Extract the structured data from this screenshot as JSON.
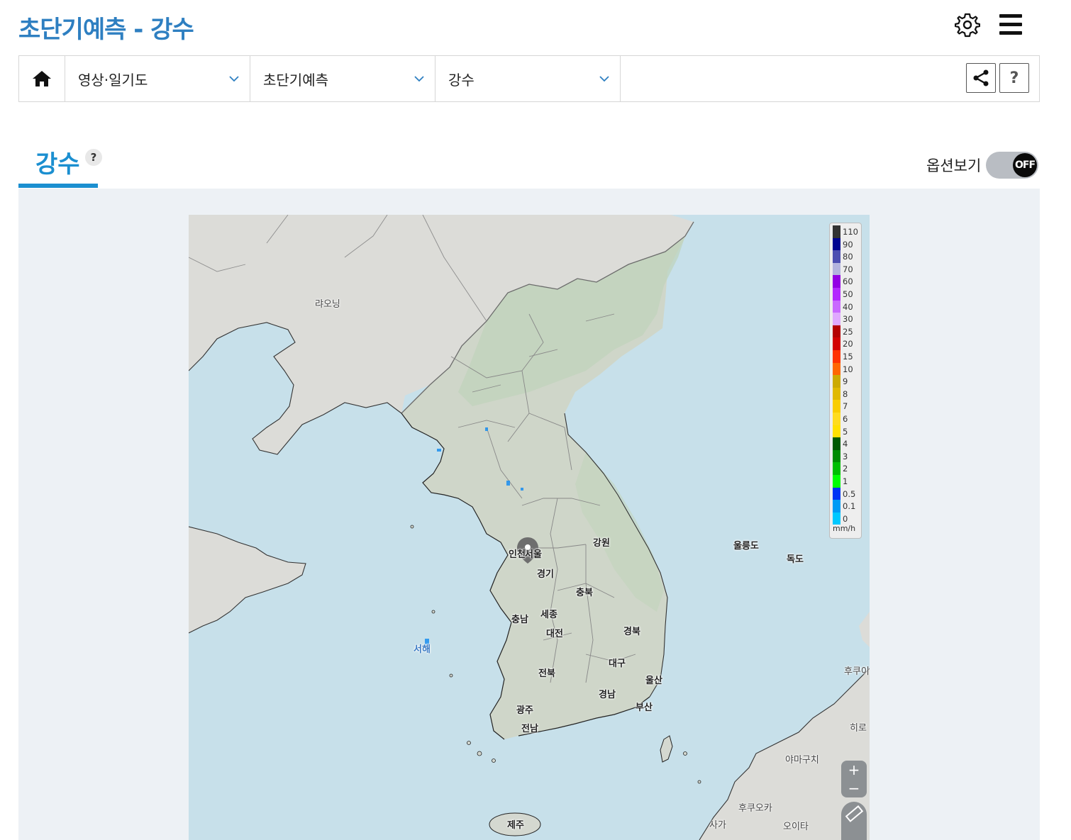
{
  "header": {
    "title": "초단기예측 - 강수"
  },
  "breadcrumb": {
    "items": [
      {
        "label": "영상·일기도"
      },
      {
        "label": "초단기예측"
      },
      {
        "label": "강수"
      }
    ]
  },
  "tabs": [
    {
      "label": "강수",
      "help": "?"
    }
  ],
  "options": {
    "label": "옵션보기",
    "toggle_state": "OFF"
  },
  "help_button": "?",
  "map": {
    "labels": {
      "liaoning": "랴오닝",
      "seoul": "서울",
      "incheon": "인천",
      "gangwon": "강원",
      "gyeonggi": "경기",
      "chungbuk": "충북",
      "chungnam": "충남",
      "sejong": "세종",
      "daejeon": "대전",
      "gyeongbuk": "경북",
      "daegu": "대구",
      "jeonbuk": "전북",
      "ulsan": "울산",
      "gyeongnam": "경남",
      "busan": "부산",
      "gwangju": "광주",
      "jeonnam": "전남",
      "jeju": "제주",
      "ulleungdo": "울릉도",
      "dokdo": "독도",
      "west_sea": "서해",
      "fukuoka": "후쿠오카",
      "yamaguchi": "야마구치",
      "hiroshima": "히로",
      "hukui": "후쿠이",
      "saga": "사가",
      "oita": "오이타"
    },
    "zoom_in": "+",
    "zoom_out": "−",
    "legend": {
      "unit": "mm/h",
      "items": [
        {
          "value": "110",
          "color": "#333333"
        },
        {
          "value": "90",
          "color": "#000390"
        },
        {
          "value": "80",
          "color": "#4c4eb1"
        },
        {
          "value": "70",
          "color": "#b3b4de"
        },
        {
          "value": "60",
          "color": "#9300e4"
        },
        {
          "value": "50",
          "color": "#b329ff"
        },
        {
          "value": "40",
          "color": "#c969ff"
        },
        {
          "value": "30",
          "color": "#e0a9ff"
        },
        {
          "value": "25",
          "color": "#b40000"
        },
        {
          "value": "20",
          "color": "#d20000"
        },
        {
          "value": "15",
          "color": "#ff3200"
        },
        {
          "value": "10",
          "color": "#ff6600"
        },
        {
          "value": "9",
          "color": "#ccaa00"
        },
        {
          "value": "8",
          "color": "#e0b900"
        },
        {
          "value": "7",
          "color": "#f9cd00"
        },
        {
          "value": "6",
          "color": "#ffdc1f"
        },
        {
          "value": "5",
          "color": "#ffe100"
        },
        {
          "value": "4",
          "color": "#005a00"
        },
        {
          "value": "3",
          "color": "#008c00"
        },
        {
          "value": "2",
          "color": "#00be00"
        },
        {
          "value": "1",
          "color": "#00ff00"
        },
        {
          "value": "0.5",
          "color": "#0033f5"
        },
        {
          "value": "0.1",
          "color": "#009bf5"
        },
        {
          "value": "0",
          "color": "#00c8ff"
        }
      ]
    }
  },
  "colors": {
    "title": "#2e7fc1",
    "tab_accent": "#1b8fd0",
    "sea": "#c7e0ea",
    "land": "#d9dcd6",
    "panel_bg": "#edf1f5"
  },
  "icons": [
    "gear-icon",
    "menu-icon",
    "home-icon",
    "chevron-down-icon",
    "share-icon",
    "map-pin-icon",
    "ruler-icon"
  ]
}
